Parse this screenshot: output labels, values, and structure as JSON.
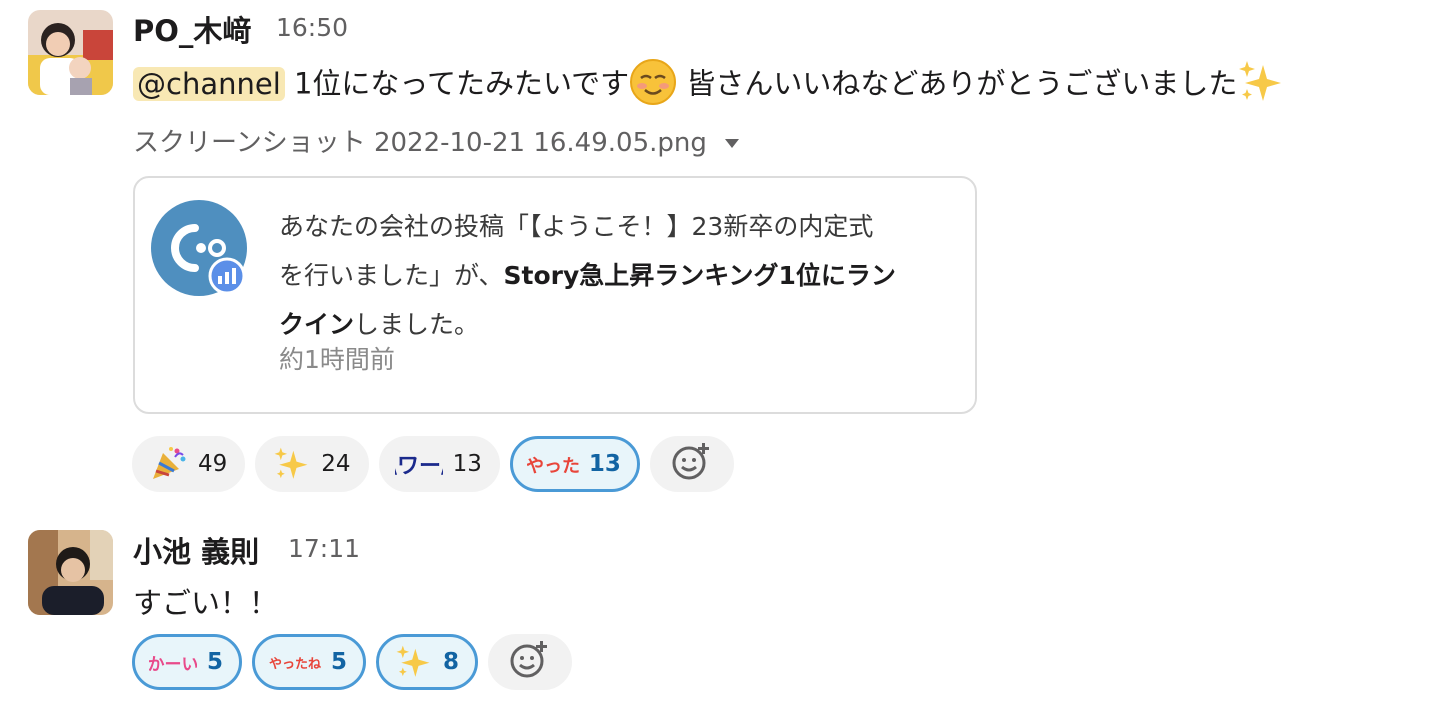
{
  "messages": [
    {
      "author": "PO_木﨑",
      "time": "16:50",
      "mention": "@channel",
      "text_before_emoji": " 1位になってたみたいです",
      "text_after_emoji": " 皆さんいいねなどありがとうございました",
      "attachment": {
        "filename": "スクリーンショット 2022-10-21 16.49.05.png",
        "card": {
          "line1": "あなたの会社の投稿「【ようこそ！】23新卒の内定式",
          "line2_plain": "を行いました」が、",
          "line2_bold": "Story急上昇ランキング1位にラン",
          "line3_bold": "クイン",
          "line3_plain": "しました。",
          "timestamp": "約1時間前"
        }
      },
      "reactions": [
        {
          "emoji": "party-popper",
          "count": "49",
          "mine": false
        },
        {
          "emoji": "sparkles",
          "count": "24",
          "mine": false
        },
        {
          "emoji": "custom-wa",
          "label": "\\ワー/",
          "count": "13",
          "mine": false
        },
        {
          "emoji": "custom-yatta",
          "label": "やった",
          "count": "13",
          "mine": true
        }
      ]
    },
    {
      "author": "小池 義則",
      "time": "17:11",
      "text": "すごい！！",
      "reactions": [
        {
          "emoji": "custom-kawaii",
          "label": "かーい",
          "count": "5",
          "mine": true
        },
        {
          "emoji": "custom-yattane",
          "label": "やったね",
          "count": "5",
          "mine": true
        },
        {
          "emoji": "sparkles",
          "count": "8",
          "mine": true
        }
      ]
    }
  ],
  "colors": {
    "mention_bg": "#f8e8b4",
    "reaction_selected_border": "#4a9ad6",
    "reaction_selected_text": "#1264a3"
  }
}
